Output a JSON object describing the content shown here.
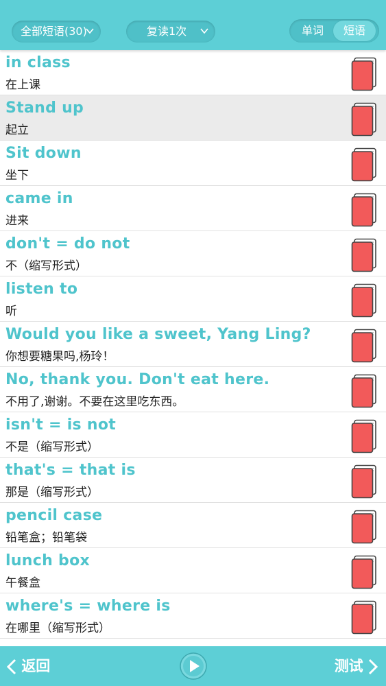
{
  "header": {
    "filter_all": "全部短语(30)",
    "filter_repeat": "复读1次",
    "toggle": {
      "words": "单词",
      "phrases": "短语",
      "active": "phrases"
    }
  },
  "phrases": [
    {
      "en": "in class",
      "zh": "在上课"
    },
    {
      "en": "Stand up",
      "zh": "起立",
      "selected": true
    },
    {
      "en": "Sit down",
      "zh": "坐下"
    },
    {
      "en": "came in",
      "zh": "进来"
    },
    {
      "en": "don't = do not",
      "zh": "不（缩写形式）"
    },
    {
      "en": "listen to",
      "zh": "听"
    },
    {
      "en": "Would you like a sweet, Yang Ling?",
      "zh": "你想要糖果吗,杨玲！"
    },
    {
      "en": "No, thank you. Don't eat here.",
      "zh": "不用了,谢谢。不要在这里吃东西。"
    },
    {
      "en": "isn't = is not",
      "zh": "不是（缩写形式）"
    },
    {
      "en": "that's = that is",
      "zh": "那是（缩写形式）"
    },
    {
      "en": "pencil case",
      "zh": "铅笔盒；铅笔袋"
    },
    {
      "en": "lunch box",
      "zh": "午餐盒"
    },
    {
      "en": "where's = where is",
      "zh": "在哪里（缩写形式）"
    }
  ],
  "footer": {
    "back_label": "返回",
    "play_icon": "play-icon",
    "test_label": "测试"
  },
  "colors": {
    "bar": "#5dcfd6",
    "english_text": "#4fc4cc",
    "book_cover": "#f25a5a"
  }
}
